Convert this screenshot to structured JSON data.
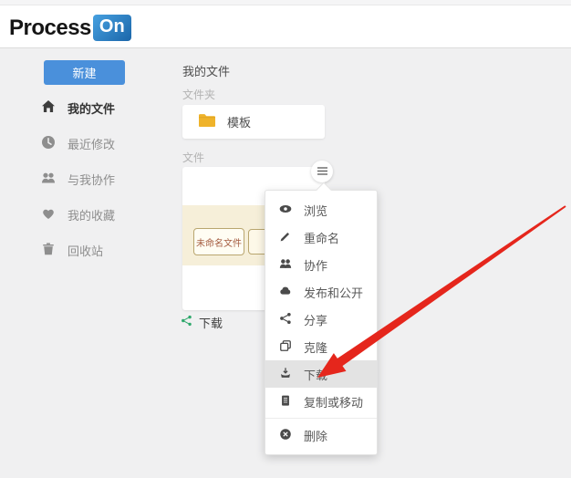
{
  "header": {
    "logo_process": "Process",
    "logo_on": "On"
  },
  "sidebar": {
    "new_button_label": "新建",
    "items": [
      {
        "label": "我的文件",
        "icon": "home-icon",
        "active": true
      },
      {
        "label": "最近修改",
        "icon": "clock-icon",
        "active": false
      },
      {
        "label": "与我协作",
        "icon": "people-icon",
        "active": false
      },
      {
        "label": "我的收藏",
        "icon": "heart-icon",
        "active": false
      },
      {
        "label": "回收站",
        "icon": "trash-icon",
        "active": false
      }
    ]
  },
  "main": {
    "title": "我的文件",
    "folders_section_label": "文件夹",
    "folder_card": {
      "name": "模板",
      "icon": "folder-icon"
    },
    "files_section_label": "文件",
    "file_card": {
      "preview_node_text": "未命名文件",
      "file_name": "下载",
      "file_type_icon": "flowchart-share-icon"
    }
  },
  "context_menu": {
    "items": [
      {
        "label": "浏览",
        "icon": "eye-icon",
        "highlighted": false
      },
      {
        "label": "重命名",
        "icon": "pencil-icon",
        "highlighted": false
      },
      {
        "label": "协作",
        "icon": "people-icon",
        "highlighted": false
      },
      {
        "label": "发布和公开",
        "icon": "cloud-icon",
        "highlighted": false
      },
      {
        "label": "分享",
        "icon": "share-icon",
        "highlighted": false
      },
      {
        "label": "克隆",
        "icon": "clone-icon",
        "highlighted": false
      },
      {
        "label": "下载",
        "icon": "download-icon",
        "highlighted": true
      },
      {
        "label": "复制或移动",
        "icon": "copy-icon",
        "highlighted": false
      },
      {
        "label": "删除",
        "icon": "delete-icon",
        "highlighted": false
      }
    ]
  },
  "annotation": {
    "type": "red-arrow",
    "points_to": "下载",
    "color": "#e5261c"
  },
  "colors": {
    "accent_blue": "#4a90db",
    "page_background": "#f0f0f1",
    "menu_highlight": "#e3e3e3",
    "folder_yellow": "#efb32a",
    "preview_band_cream": "#f6efd9",
    "preview_node_text": "#a55d41",
    "file_type_green": "#2fa86c",
    "arrow_red": "#e5261c"
  }
}
